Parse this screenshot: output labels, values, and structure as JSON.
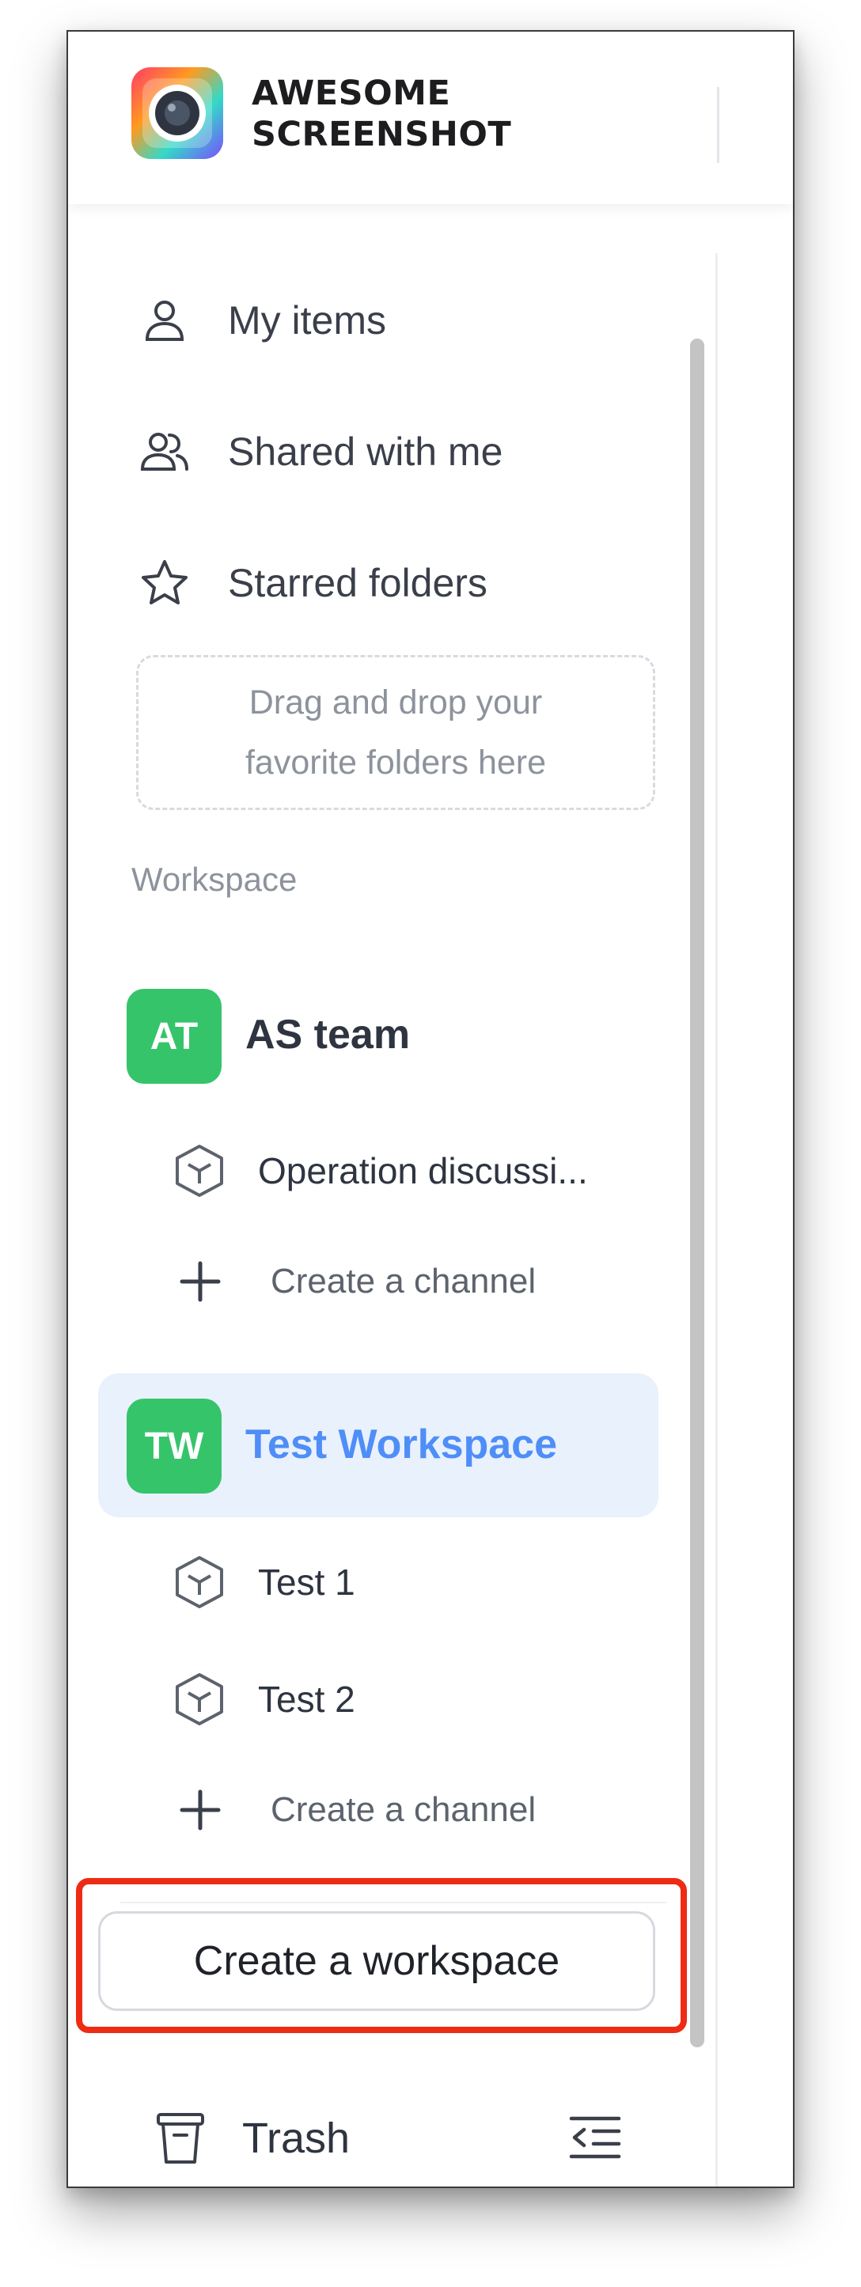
{
  "brand": {
    "line1": "AWESOME",
    "line2": "SCREENSHOT"
  },
  "nav": [
    {
      "label": "My items",
      "icon": "person-icon"
    },
    {
      "label": "Shared with me",
      "icon": "people-icon"
    },
    {
      "label": "Starred folders",
      "icon": "star-icon"
    }
  ],
  "dropzone": {
    "text": "Drag and drop your favorite folders here"
  },
  "workspace_section": {
    "title": "Workspace"
  },
  "workspaces": [
    {
      "initials": "AT",
      "name": "AS team",
      "active": false,
      "channels": [
        {
          "label": "Operation discussi..."
        }
      ],
      "create_channel_label": "Create a channel"
    },
    {
      "initials": "TW",
      "name": "Test Workspace",
      "active": true,
      "channels": [
        {
          "label": "Test 1"
        },
        {
          "label": "Test 2"
        }
      ],
      "create_channel_label": "Create a channel"
    }
  ],
  "create_workspace": {
    "label": "Create a workspace"
  },
  "trash": {
    "label": "Trash"
  },
  "colors": {
    "avatar_green": "#36c46b",
    "active_bg": "#e9f1fd",
    "active_text": "#4f8ef7",
    "highlight_red": "#ee2b14"
  }
}
